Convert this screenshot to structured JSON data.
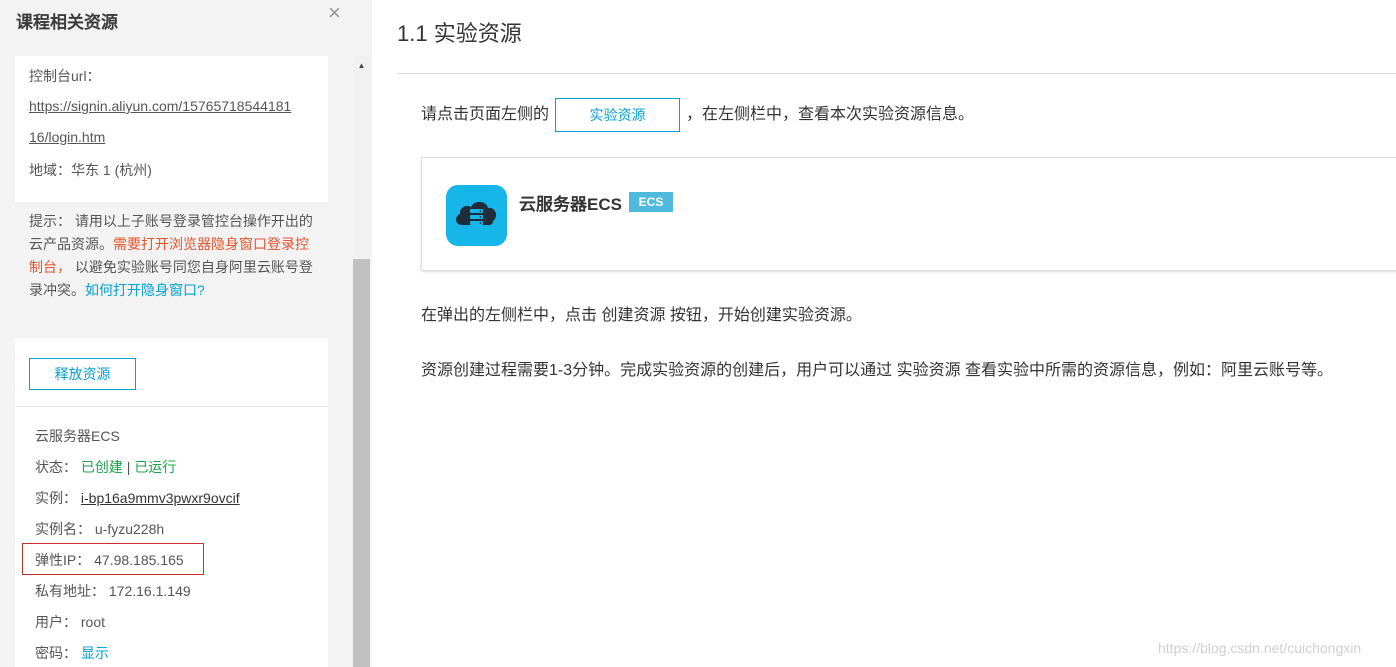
{
  "panel": {
    "title": "课程相关资源",
    "close_icon": "×",
    "console": {
      "url_label": "控制台url：",
      "url_line1": "https://signin.aliyun.com/15765718544181",
      "url_line2": "16/login.htm",
      "region": "地域：华东 1 (杭州)"
    },
    "tip": {
      "prefix": "提示： 请用以上子账号登录管控台操作开出的云产品资源。",
      "red": "需要打开浏览器隐身窗口登录控制台，",
      "middle": " 以避免实验账号同您自身阿里云账号登录冲突。",
      "link": "如何打开隐身窗口?"
    },
    "release_button": "释放资源",
    "resource": {
      "name": "云服务器ECS",
      "status_label": "状态：",
      "status_created": "已创建",
      "status_sep": "|",
      "status_running": "已运行",
      "instance_label": "实例：",
      "instance_id": "i-bp16a9mmv3pwxr9ovcif",
      "instance_name_label": "实例名：",
      "instance_name": "u-fyzu228h",
      "eip_label": "弹性IP：",
      "eip": "47.98.185.165",
      "private_label": "私有地址：",
      "private_ip": "172.16.1.149",
      "user_label": "用户：",
      "user": "root",
      "password_label": "密码：",
      "password_show": "显示"
    }
  },
  "main": {
    "title": "1.1 实验资源",
    "para1_before": "请点击页面左侧的",
    "para1_button": "实验资源",
    "para1_after": "，在左侧栏中，查看本次实验资源信息。",
    "card": {
      "icon": "cloud-server-icon",
      "name": "云服务器ECS",
      "badge": "ECS"
    },
    "para2": "在弹出的左侧栏中，点击 创建资源 按钮，开始创建实验资源。",
    "para3": "资源创建过程需要1-3分钟。完成实验资源的创建后，用户可以通过 实验资源 查看实验中所需的资源信息，例如：阿里云账号等。"
  },
  "watermark": "https://blog.csdn.net/cuichongxin",
  "colors": {
    "accent": "#00a1d6",
    "warning_red": "#e4542d",
    "status_green": "#1aa54a",
    "highlight_box": "#c9302c",
    "ecs_icon": "#16b6e8"
  }
}
